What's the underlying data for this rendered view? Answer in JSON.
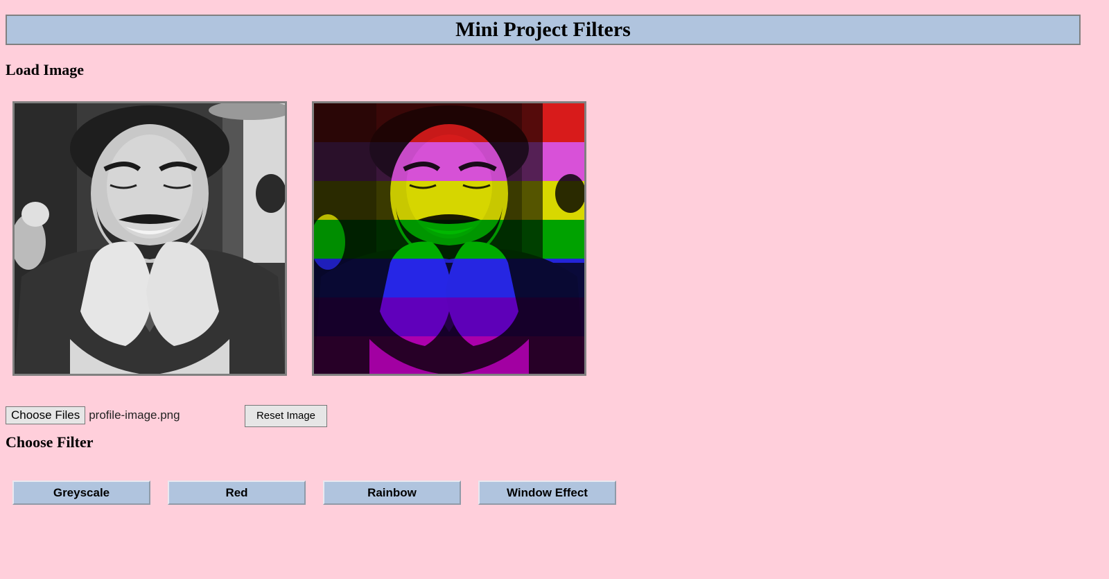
{
  "header": {
    "title": "Mini Project Filters"
  },
  "load_section": {
    "heading": "Load Image"
  },
  "file_input": {
    "button_label": "Choose Files",
    "file_name": "profile-image.png"
  },
  "reset": {
    "label": "Reset Image"
  },
  "filter_section": {
    "heading": "Choose Filter",
    "buttons": [
      {
        "label": "Greyscale"
      },
      {
        "label": "Red"
      },
      {
        "label": "Rainbow"
      },
      {
        "label": "Window Effect"
      }
    ]
  },
  "colors": {
    "page_background": "#ffcfdb",
    "accent": "#b0c4de",
    "border": "#808080",
    "rainbow_bands": [
      "#ff0000",
      "#ff8c00",
      "#ffff00",
      "#00c000",
      "#0000ff",
      "#4b0082",
      "#8b008b"
    ]
  }
}
